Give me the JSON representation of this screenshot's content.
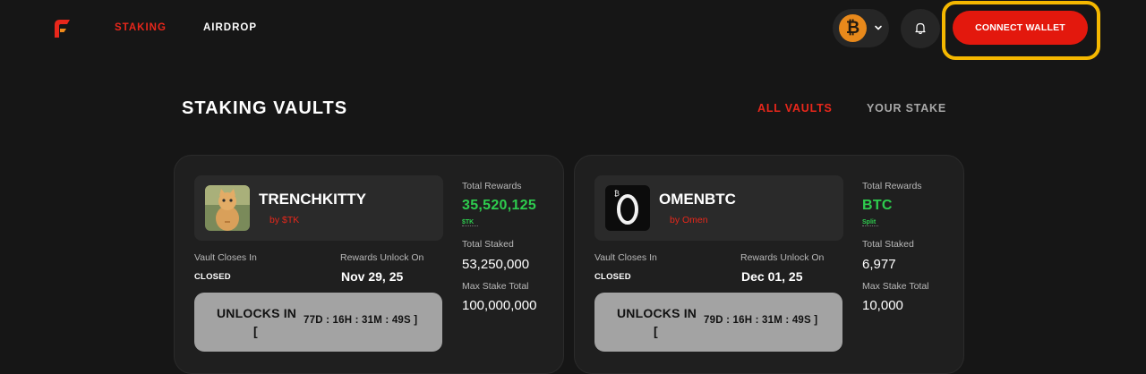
{
  "nav": {
    "links": [
      "STAKING",
      "AIRDROP"
    ],
    "connect_wallet": "CONNECT WALLET",
    "chain_symbol": "₿"
  },
  "page": {
    "title": "STAKING VAULTS",
    "tabs": [
      "ALL VAULTS",
      "YOUR STAKE"
    ]
  },
  "vaults": [
    {
      "name": "TRENCHKITTY",
      "by": "by $TK",
      "vault_closes_label": "Vault Closes In",
      "vault_status": "CLOSED",
      "rewards_unlock_label": "Rewards Unlock On",
      "rewards_unlock_date": "Nov 29, 25",
      "unlock_title": "UNLOCKS IN",
      "unlock_bracket": "[",
      "unlock_time": "77D : 16H : 31M : 49S  ]",
      "total_rewards_label": "Total Rewards",
      "total_rewards": "35,520,125",
      "reward_unit": "$TK",
      "total_staked_label": "Total Staked",
      "total_staked": "53,250,000",
      "max_stake_label": "Max Stake Total",
      "max_stake": "100,000,000"
    },
    {
      "name": "OMENBTC",
      "by": "by Omen",
      "vault_closes_label": "Vault Closes In",
      "vault_status": "CLOSED",
      "rewards_unlock_label": "Rewards Unlock On",
      "rewards_unlock_date": "Dec 01, 25",
      "unlock_title": "UNLOCKS IN",
      "unlock_bracket": "[",
      "unlock_time": "79D : 16H : 31M : 49S  ]",
      "total_rewards_label": "Total Rewards",
      "total_rewards": "BTC",
      "reward_unit": "Split",
      "total_staked_label": "Total Staked",
      "total_staked": "6,977",
      "max_stake_label": "Max Stake Total",
      "max_stake": "10,000"
    }
  ],
  "colors": {
    "accent": "#e8271b",
    "highlight_outline": "#f5b800",
    "reward_green": "#2ecc4e"
  }
}
